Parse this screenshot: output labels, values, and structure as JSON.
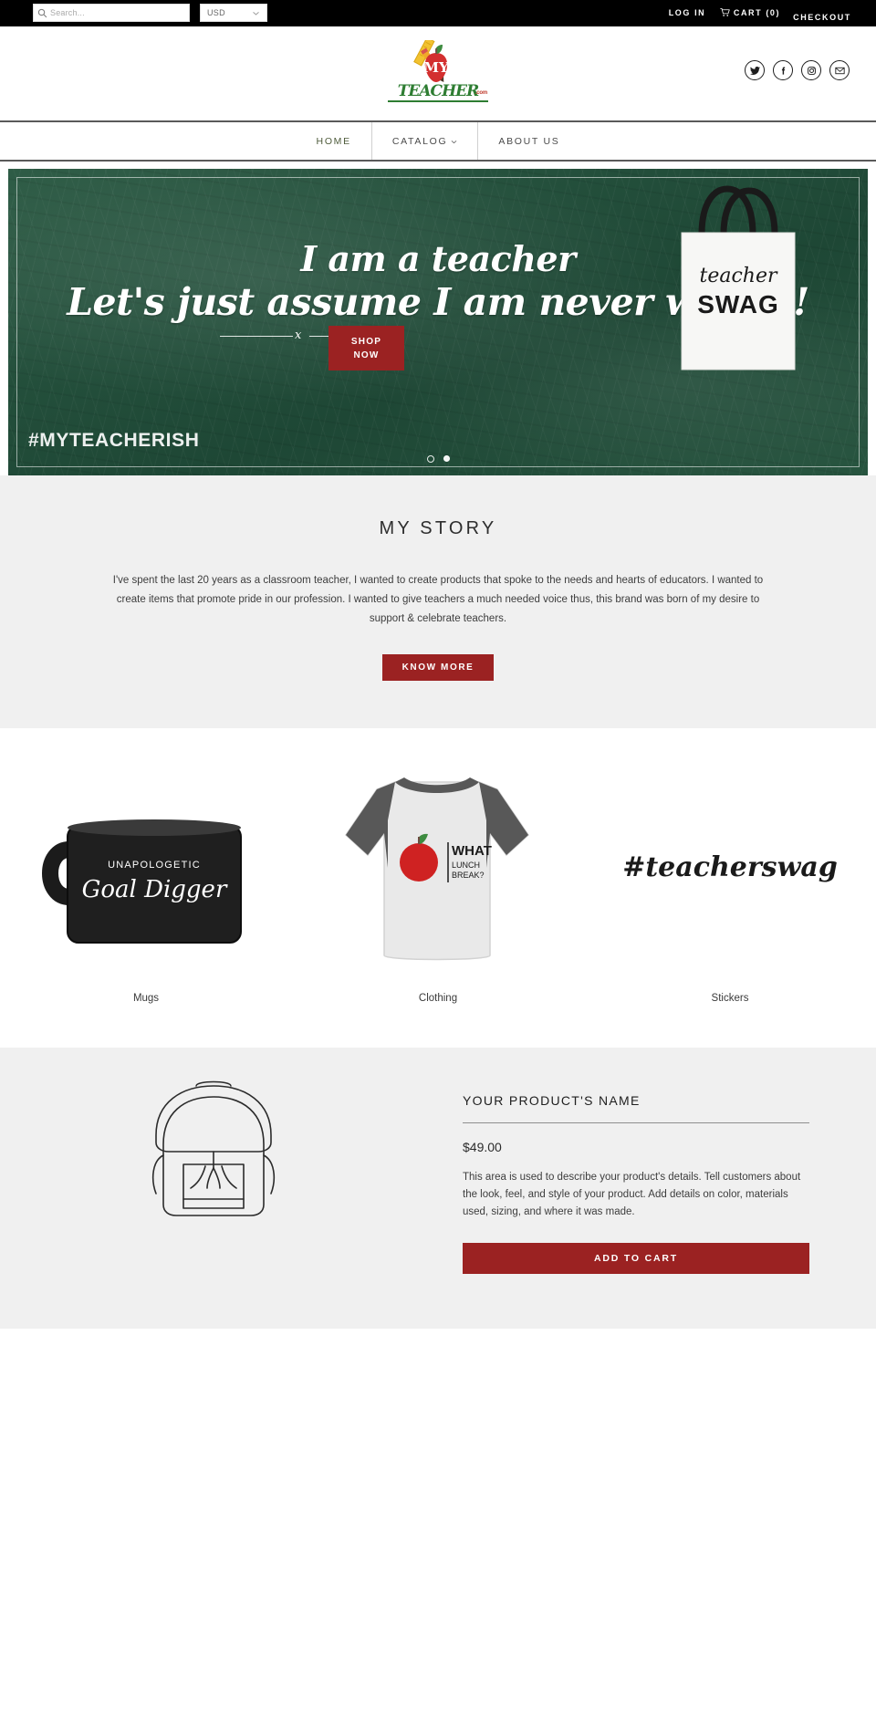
{
  "topbar": {
    "search": {
      "placeholder": "Search...",
      "value": "",
      "icon": "search-icon"
    },
    "currency": {
      "selected": "USD",
      "options": [
        "USD"
      ],
      "icon": "chevron-down-icon"
    },
    "links": [
      {
        "name": "login",
        "label": "LOG IN"
      },
      {
        "name": "cart",
        "label": "CART (0)",
        "icon": "cart-icon"
      },
      {
        "name": "checkout",
        "label": "CHECKOUT"
      }
    ]
  },
  "header": {
    "logo": {
      "apple_text": "MY",
      "word": "TEACHER",
      "suffix": ".com",
      "alt": "My Teacher"
    },
    "social": [
      {
        "name": "twitter",
        "label": "Twitter"
      },
      {
        "name": "facebook",
        "label": "Facebook"
      },
      {
        "name": "instagram",
        "label": "Instagram"
      },
      {
        "name": "email",
        "label": "Email"
      }
    ]
  },
  "nav": {
    "items": [
      {
        "name": "home",
        "label": "HOME",
        "active": true,
        "dropdown": false
      },
      {
        "name": "catalog",
        "label": "CATALOG",
        "active": false,
        "dropdown": true
      },
      {
        "name": "about-us",
        "label": "ABOUT US",
        "active": false,
        "dropdown": false
      }
    ]
  },
  "hero": {
    "line1": "I am a teacher",
    "line2": "Let's just assume I am never wrong!",
    "divider_mark": "x",
    "button_line1": "SHOP",
    "button_line2": "NOW",
    "tote_script": "teacher",
    "tote_block": "SWAG",
    "hashtag": "#MYTEACHERISH",
    "slides": 2,
    "active_slide": 1,
    "accent_color": "#9b2222",
    "board_color": "#24503c"
  },
  "story": {
    "heading": "MY STORY",
    "body": "I've spent the last 20 years as a classroom teacher, I wanted to create products that spoke to the needs and hearts of educators. I wanted to create items that promote pride in our profession. I wanted to give teachers a much needed voice thus, this brand was born of my desire to support & celebrate teachers.",
    "button_label": "KNOW MORE"
  },
  "collections": [
    {
      "name": "mugs",
      "label": "Mugs",
      "art": "mug",
      "mug_top": "UNAPOLOGETIC",
      "mug_script": "Goal Digger"
    },
    {
      "name": "clothing",
      "label": "Clothing",
      "art": "raglan-shirt",
      "shirt_text_1": "WHAT",
      "shirt_text_2": "LUNCH",
      "shirt_text_3": "BREAK?"
    },
    {
      "name": "stickers",
      "label": "Stickers",
      "art": "sticker",
      "sticker_text": "#teacherswag"
    }
  ],
  "feature": {
    "title": "YOUR PRODUCT'S NAME",
    "price": "$49.00",
    "description": "This area is used to describe your product's details. Tell customers about the look, feel, and style of your product. Add details on color, materials used, sizing, and where it was made.",
    "button_label": "ADD TO CART",
    "illustration": "backpack-line-art"
  }
}
